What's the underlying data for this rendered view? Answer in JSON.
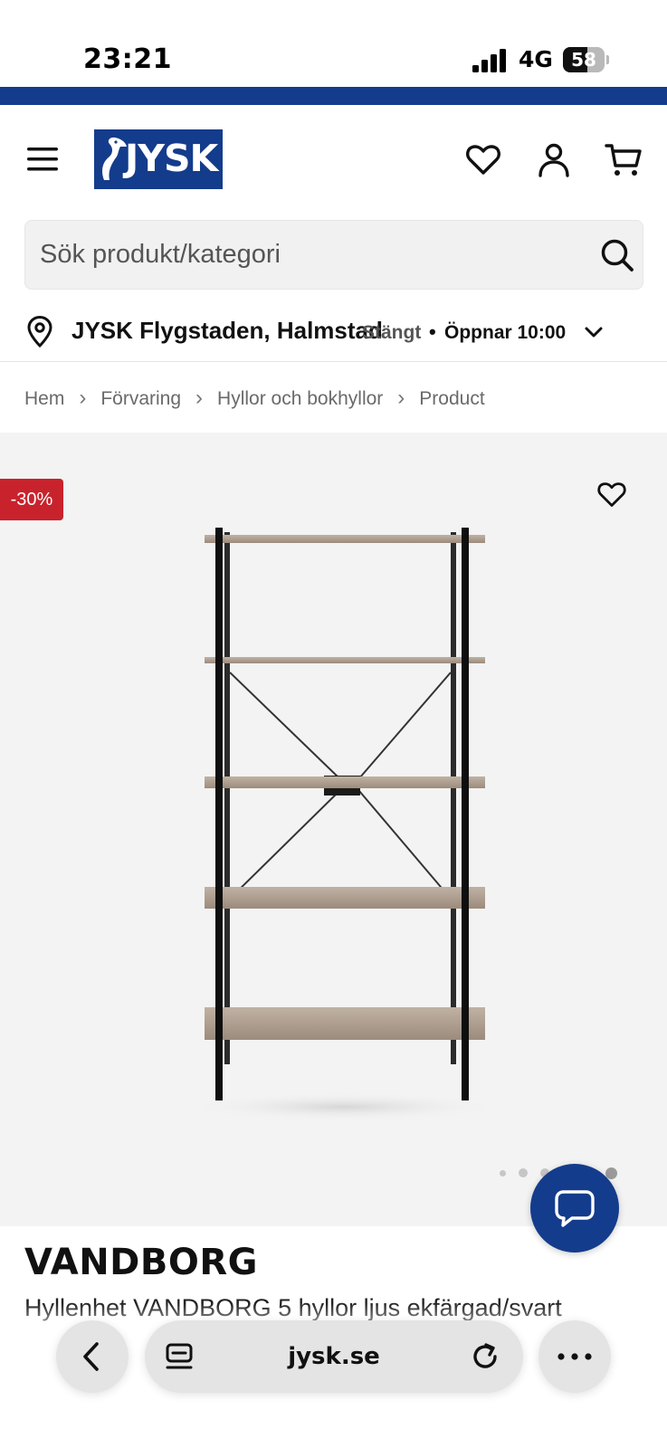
{
  "status_bar": {
    "time": "23:21",
    "network": "4G",
    "battery": "58",
    "battery_level": 0.58,
    "signal_bars": 4
  },
  "header": {
    "logo_text": "JYSK",
    "brand_color": "#143c8c"
  },
  "search": {
    "placeholder": "Sök produkt/kategori"
  },
  "store": {
    "name": "JYSK Flygstaden, Halmstad",
    "status": "Stängt",
    "separator": "•",
    "opens": "Öppnar 10:00"
  },
  "breadcrumb": {
    "items": [
      "Hem",
      "Förvaring",
      "Hyllor och bokhyllor",
      "Product"
    ],
    "separator": "›"
  },
  "product": {
    "discount_badge": "-30%",
    "discount_color": "#c8232c",
    "name": "VANDBORG",
    "subtitle": "Hyllenhet VANDBORG 5 hyllor ljus ekfärgad/svart",
    "image_count": 6,
    "active_image": 6
  },
  "browser": {
    "url": "jysk.se"
  }
}
